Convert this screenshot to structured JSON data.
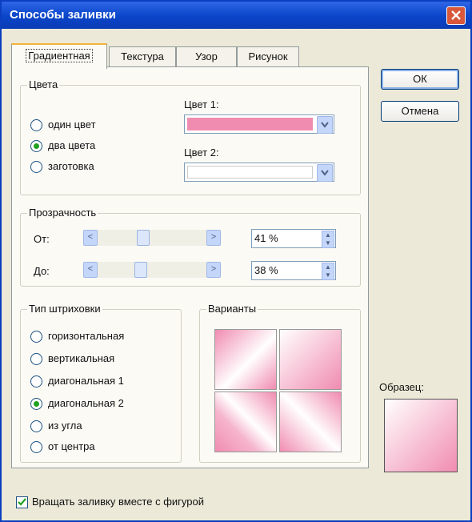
{
  "window": {
    "title": "Способы заливки"
  },
  "tabs": [
    {
      "label": "Градиентная"
    },
    {
      "label": "Текстура"
    },
    {
      "label": "Узор"
    },
    {
      "label": "Рисунок"
    }
  ],
  "colors_group": {
    "legend": "Цвета",
    "options": [
      {
        "label": "один цвет",
        "selected": false
      },
      {
        "label": "два цвета",
        "selected": true
      },
      {
        "label": "заготовка",
        "selected": false
      }
    ],
    "color1_label": "Цвет 1:",
    "color1_value": "#f08cb0",
    "color2_label": "Цвет 2:",
    "color2_value": "#ffffff"
  },
  "transparency": {
    "legend": "Прозрачность",
    "from_label": "От:",
    "from_value": "41 %",
    "from_level": 0.41,
    "to_label": "До:",
    "to_value": "38 %",
    "to_level": 0.38
  },
  "shading": {
    "legend": "Тип штриховки",
    "options": [
      {
        "label": "горизонтальная",
        "selected": false
      },
      {
        "label": "вертикальная",
        "selected": false
      },
      {
        "label": "диагональная 1",
        "selected": false
      },
      {
        "label": "диагональная 2",
        "selected": true
      },
      {
        "label": "из угла",
        "selected": false
      },
      {
        "label": "от центра",
        "selected": false
      }
    ]
  },
  "variants": {
    "legend": "Варианты"
  },
  "buttons": {
    "ok": "ОК",
    "cancel": "Отмена"
  },
  "sample": {
    "label": "Образец:"
  },
  "rotate_checkbox": {
    "label": "Вращать заливку вместе с фигурой",
    "checked": true
  },
  "accent_colors": {
    "title_bar": "#0a45c9",
    "pink": "#f08cb0",
    "dialog_bg": "#ece9d8"
  }
}
